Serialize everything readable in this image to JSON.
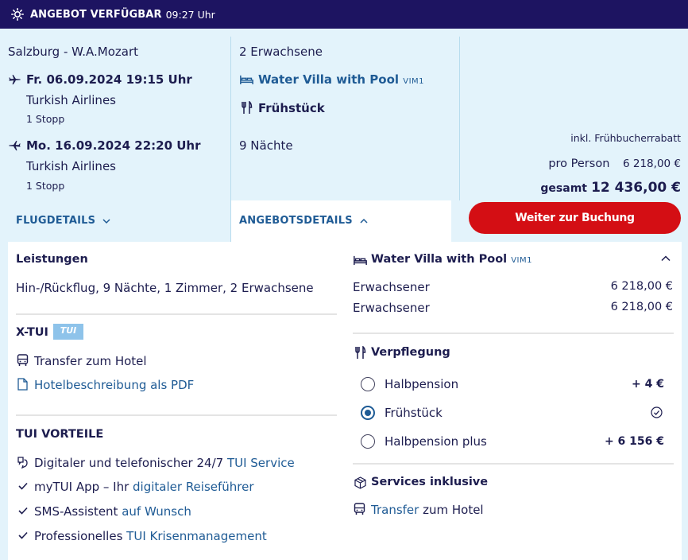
{
  "banner": {
    "title": "ANGEBOT VERFÜGBAR",
    "time": "09:27 Uhr"
  },
  "flight": {
    "origin": "Salzburg - W.A.Mozart",
    "outbound": {
      "date": "Fr. 06.09.2024 19:15 Uhr",
      "airline": "Turkish Airlines",
      "stops": "1 Stopp"
    },
    "inbound": {
      "date": "Mo. 16.09.2024 22:20 Uhr",
      "airline": "Turkish Airlines",
      "stops": "1 Stopp"
    },
    "details_label": "FLUGDETAILS"
  },
  "offer": {
    "travellers": "2 Erwachsene",
    "room": "Water Villa with Pool",
    "room_code": "VIM1",
    "board": "Frühstück",
    "nights": "9 Nächte",
    "details_label": "ANGEBOTSDETAILS"
  },
  "price": {
    "discount_note": "inkl. Frühbucherrabatt",
    "per_person_label": "pro Person",
    "per_person_value": "6 218,00 €",
    "total_label": "gesamt",
    "total_value": "12 436,00 €",
    "book_button": "Weiter zur Buchung"
  },
  "details": {
    "services_title": "Leistungen",
    "services_text": "Hin-/Rückflug, 9 Nächte, 1 Zimmer, 2 Erwachsene",
    "xtui_title": "X-TUI",
    "xtui_badge": "TUI",
    "transfer": "Transfer zum Hotel",
    "hotel_pdf": "Hotelbeschreibung als PDF",
    "benefits_title": "TUI VORTEILE",
    "benefits": [
      {
        "text": "Digitaler und telefonischer 24/7 ",
        "link": "TUI Service"
      },
      {
        "text": "myTUI App – Ihr ",
        "link": "digitaler Reiseführer"
      },
      {
        "text": "SMS-Assistent ",
        "link": "auf Wunsch"
      },
      {
        "text": "Professionelles ",
        "link": "TUI Krisenmanagement"
      }
    ],
    "room_title": "Water Villa with Pool",
    "room_code": "VIM1",
    "persons": [
      {
        "label": "Erwachsener",
        "price": "6 218,00 €"
      },
      {
        "label": "Erwachsener",
        "price": "6 218,00 €"
      }
    ],
    "board_title": "Verpflegung",
    "board_options": [
      {
        "label": "Halbpension",
        "price": "+ 4 €",
        "selected": false
      },
      {
        "label": "Frühstück",
        "price": "",
        "selected": true
      },
      {
        "label": "Halbpension plus",
        "price": "+ 6 156 €",
        "selected": false
      }
    ],
    "included_title": "Services inklusive",
    "included_link": "Transfer",
    "included_rest": " zum Hotel"
  },
  "icons": {
    "banner": "sun-icon",
    "outbound": "plane-depart-icon",
    "inbound": "plane-return-icon",
    "room": "bed-icon",
    "board": "cutlery-icon",
    "bus": "bus-icon",
    "pdf": "document-icon",
    "service": "phone-service-icon",
    "check": "check-icon",
    "box": "package-icon"
  }
}
